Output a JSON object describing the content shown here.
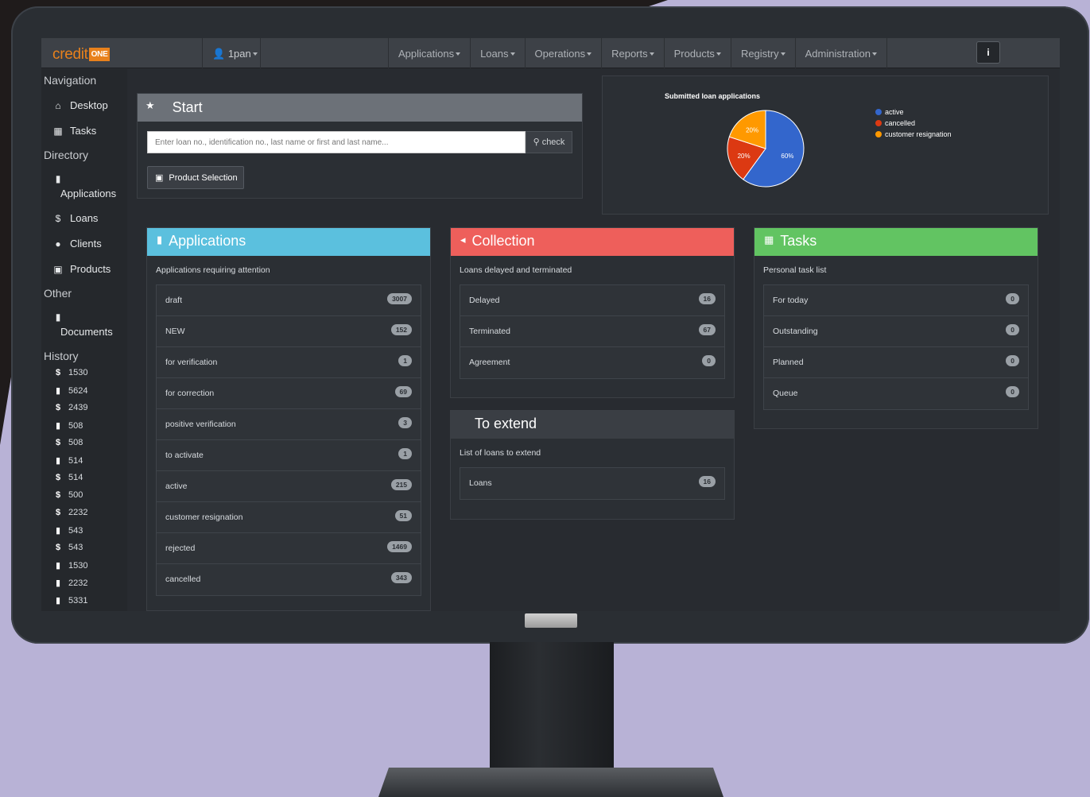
{
  "app": {
    "logo_text": "credit",
    "logo_box": "ONE",
    "user_label": "1pan"
  },
  "menu": {
    "items": [
      "Applications",
      "Loans",
      "Operations",
      "Reports",
      "Products",
      "Registry",
      "Administration"
    ],
    "info_icon": "i"
  },
  "sidebar": {
    "navigation_heading": "Navigation",
    "desktop": "Desktop",
    "tasks": "Tasks",
    "directory_heading": "Directory",
    "applications": "Applications",
    "loans": "Loans",
    "clients": "Clients",
    "products": "Products",
    "other_heading": "Other",
    "documents": "Documents",
    "history_heading": "History",
    "history": [
      {
        "icon": "dollar-icon",
        "label": "1530"
      },
      {
        "icon": "file-icon",
        "label": "5624"
      },
      {
        "icon": "dollar-icon",
        "label": "2439"
      },
      {
        "icon": "file-icon",
        "label": "508"
      },
      {
        "icon": "dollar-icon",
        "label": "508"
      },
      {
        "icon": "file-icon",
        "label": "514"
      },
      {
        "icon": "dollar-icon",
        "label": "514"
      },
      {
        "icon": "dollar-icon",
        "label": "500"
      },
      {
        "icon": "dollar-icon",
        "label": "2232"
      },
      {
        "icon": "file-icon",
        "label": "543"
      },
      {
        "icon": "dollar-icon",
        "label": "543"
      },
      {
        "icon": "file-icon",
        "label": "1530"
      },
      {
        "icon": "file-icon",
        "label": "2232"
      },
      {
        "icon": "file-icon",
        "label": "5331"
      }
    ]
  },
  "start": {
    "title": "Start",
    "search_placeholder": "Enter loan no., identification no., last name or first and last name...",
    "check_label": "check",
    "product_selection_label": "Product Selection"
  },
  "chart_data": {
    "type": "pie",
    "title": "Submitted loan applications",
    "categories": [
      "active",
      "cancelled",
      "customer resignation"
    ],
    "values": [
      60,
      20,
      20
    ],
    "value_labels": [
      "60%",
      "20%",
      "20%"
    ],
    "colors": [
      "#3366cc",
      "#dc3912",
      "#ff9900"
    ],
    "legend_position": "right"
  },
  "applications": {
    "title": "Applications",
    "subtitle": "Applications requiring attention",
    "rows": [
      {
        "label": "draft",
        "count": "3007"
      },
      {
        "label": "NEW",
        "count": "152"
      },
      {
        "label": "for verification",
        "count": "1"
      },
      {
        "label": "for correction",
        "count": "69"
      },
      {
        "label": "positive verification",
        "count": "3"
      },
      {
        "label": "to activate",
        "count": "1"
      },
      {
        "label": "active",
        "count": "215"
      },
      {
        "label": "customer resignation",
        "count": "51"
      },
      {
        "label": "rejected",
        "count": "1469"
      },
      {
        "label": "cancelled",
        "count": "343"
      }
    ]
  },
  "collection": {
    "title": "Collection",
    "subtitle": "Loans delayed and terminated",
    "rows": [
      {
        "label": "Delayed",
        "count": "16"
      },
      {
        "label": "Terminated",
        "count": "67"
      },
      {
        "label": "Agreement",
        "count": "0"
      }
    ]
  },
  "extend": {
    "title": "To extend",
    "subtitle": "List of loans to extend",
    "rows": [
      {
        "label": "Loans",
        "count": "16"
      }
    ]
  },
  "tasks": {
    "title": "Tasks",
    "subtitle": "Personal task list",
    "rows": [
      {
        "label": "For today",
        "count": "0"
      },
      {
        "label": "Outstanding",
        "count": "0"
      },
      {
        "label": "Planned",
        "count": "0"
      },
      {
        "label": "Queue",
        "count": "0"
      }
    ]
  },
  "colors": {
    "applications_header": "#5bc0de",
    "collection_header": "#ee5f5b",
    "tasks_header": "#62c462",
    "logo_accent": "#e8811c"
  }
}
